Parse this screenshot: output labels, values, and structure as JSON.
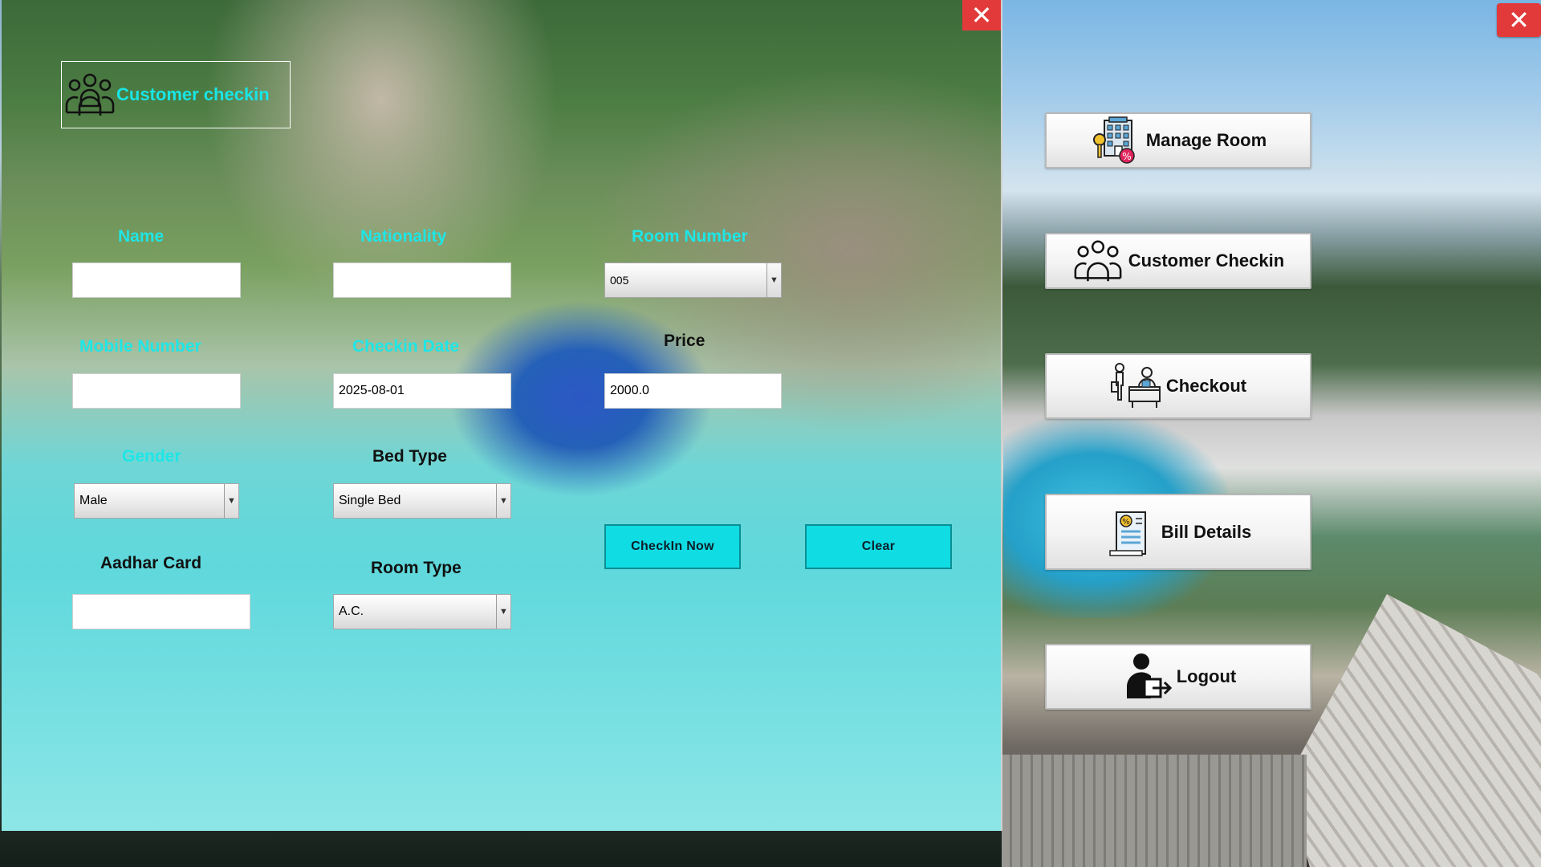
{
  "window": {
    "close_glyph": "✕"
  },
  "checkin": {
    "close_glyph": "✕",
    "header_title": "Customer checkin",
    "header_icon": "people-group-icon",
    "labels": {
      "name": "Name",
      "nationality": "Nationality",
      "room_number": "Room Number",
      "mobile_number": "Mobile Number",
      "checkin_date": "Checkin Date",
      "price": "Price",
      "gender": "Gender",
      "bed_type": "Bed Type",
      "aadhar_card": "Aadhar Card",
      "room_type": "Room Type"
    },
    "values": {
      "name": "",
      "nationality": "",
      "mobile_number": "",
      "checkin_date": "2025-08-01",
      "price": "2000.0",
      "aadhar_card": ""
    },
    "selects": {
      "room_number": "005",
      "gender": "Male",
      "bed_type": "Single Bed",
      "room_type": "A.C."
    },
    "select_arrow": "▼",
    "buttons": {
      "checkin_now": "CheckIn Now",
      "clear": "Clear"
    },
    "accent_color": "#19e5e5"
  },
  "side_menu": {
    "items": [
      {
        "label": "Manage Room",
        "icon": "hotel-building-icon"
      },
      {
        "label": "Customer Checkin",
        "icon": "people-group-icon"
      },
      {
        "label": "Checkout",
        "icon": "reception-desk-icon"
      },
      {
        "label": "Bill Details",
        "icon": "bill-receipt-icon"
      },
      {
        "label": "Logout",
        "icon": "user-logout-icon"
      }
    ]
  }
}
